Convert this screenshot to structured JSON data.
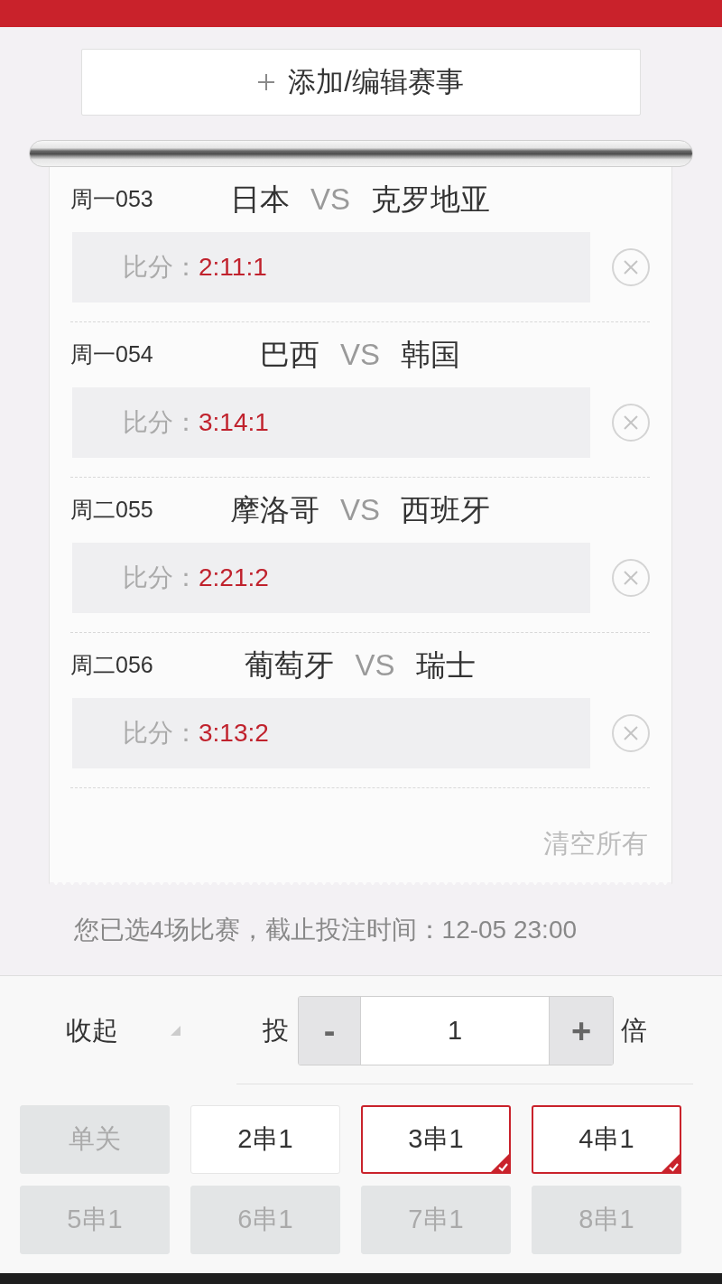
{
  "add_button": {
    "label": "添加/编辑赛事"
  },
  "matches": [
    {
      "code": "周一053",
      "home": "日本",
      "vs": "VS",
      "away": "克罗地亚",
      "score_label": "比分：",
      "score": "2:11:1"
    },
    {
      "code": "周一054",
      "home": "巴西",
      "vs": "VS",
      "away": "韩国",
      "score_label": "比分：",
      "score": "3:14:1"
    },
    {
      "code": "周二055",
      "home": "摩洛哥",
      "vs": "VS",
      "away": "西班牙",
      "score_label": "比分：",
      "score": "2:21:2"
    },
    {
      "code": "周二056",
      "home": "葡萄牙",
      "vs": "VS",
      "away": "瑞士",
      "score_label": "比分：",
      "score": "3:13:2"
    }
  ],
  "clear_all": "清空所有",
  "summary": "您已选4场比赛，截止投注时间：12-05 23:00",
  "controls": {
    "collapse": "收起",
    "bet_label": "投",
    "minus": "-",
    "value": "1",
    "plus": "+",
    "unit": "倍"
  },
  "pass_types": [
    {
      "label": "单关",
      "disabled": true,
      "selected": false
    },
    {
      "label": "2串1",
      "disabled": false,
      "selected": false
    },
    {
      "label": "3串1",
      "disabled": false,
      "selected": true
    },
    {
      "label": "4串1",
      "disabled": false,
      "selected": true
    },
    {
      "label": "5串1",
      "disabled": true,
      "selected": false
    },
    {
      "label": "6串1",
      "disabled": true,
      "selected": false
    },
    {
      "label": "7串1",
      "disabled": true,
      "selected": false
    },
    {
      "label": "8串1",
      "disabled": true,
      "selected": false
    }
  ]
}
